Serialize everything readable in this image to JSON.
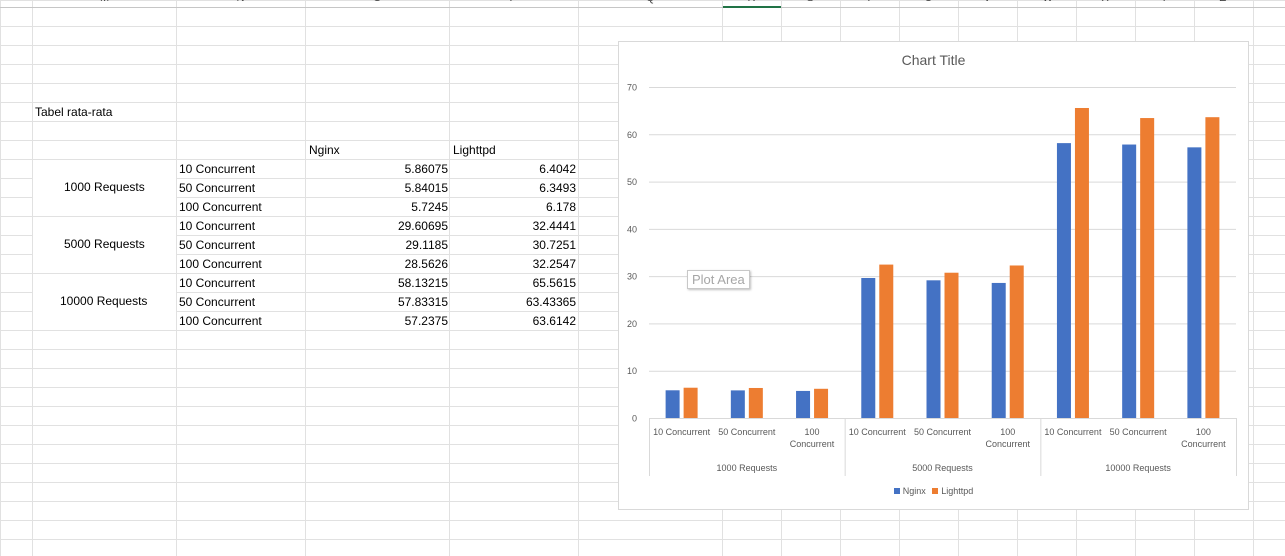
{
  "columns": [
    "M",
    "N",
    "O",
    "P",
    "Q",
    "R",
    "S",
    "T",
    "U",
    "V",
    "W",
    "X",
    "Y",
    "Z"
  ],
  "sheet": {
    "title": "Tabel rata-rata",
    "headers": {
      "nginx": "Nginx",
      "lighttpd": "Lighttpd"
    },
    "groups": [
      {
        "label": "1000 Requests",
        "rows": [
          {
            "concurrency": "10 Concurrent",
            "nginx": "5.86075",
            "lighttpd": "6.4042"
          },
          {
            "concurrency": "50 Concurrent",
            "nginx": "5.84015",
            "lighttpd": "6.3493"
          },
          {
            "concurrency": "100 Concurrent",
            "nginx": "5.7245",
            "lighttpd": "6.178"
          }
        ]
      },
      {
        "label": "5000 Requests",
        "rows": [
          {
            "concurrency": "10 Concurrent",
            "nginx": "29.60695",
            "lighttpd": "32.4441"
          },
          {
            "concurrency": "50 Concurrent",
            "nginx": "29.1185",
            "lighttpd": "30.7251"
          },
          {
            "concurrency": "100 Concurrent",
            "nginx": "28.5626",
            "lighttpd": "32.2547"
          }
        ]
      },
      {
        "label": "10000 Requests",
        "rows": [
          {
            "concurrency": "10 Concurrent",
            "nginx": "58.13215",
            "lighttpd": "65.5615"
          },
          {
            "concurrency": "50 Concurrent",
            "nginx": "57.83315",
            "lighttpd": "63.43365"
          },
          {
            "concurrency": "100 Concurrent",
            "nginx": "57.2375",
            "lighttpd": "63.6142"
          }
        ]
      }
    ]
  },
  "chart_ui": {
    "plot_area_tooltip": "Plot Area"
  },
  "chart_data": {
    "type": "bar",
    "title": "Chart Title",
    "groups": [
      "1000 Requests",
      "5000 Requests",
      "10000 Requests"
    ],
    "categories": [
      "10 Concurrent",
      "50 Concurrent",
      "100 Concurrent",
      "10 Concurrent",
      "50 Concurrent",
      "100 Concurrent",
      "10 Concurrent",
      "50 Concurrent",
      "100 Concurrent"
    ],
    "series": [
      {
        "name": "Nginx",
        "color": "#4472c4",
        "values": [
          5.86075,
          5.84015,
          5.7245,
          29.60695,
          29.1185,
          28.5626,
          58.13215,
          57.83315,
          57.2375
        ]
      },
      {
        "name": "Lighttpd",
        "color": "#ed7d31",
        "values": [
          6.4042,
          6.3493,
          6.178,
          32.4441,
          30.7251,
          32.2547,
          65.5615,
          63.43365,
          63.6142
        ]
      }
    ],
    "yticks": [
      0,
      10,
      20,
      30,
      40,
      50,
      60,
      70
    ],
    "ylim": [
      0,
      70
    ],
    "grid": true,
    "legend": "bottom"
  }
}
